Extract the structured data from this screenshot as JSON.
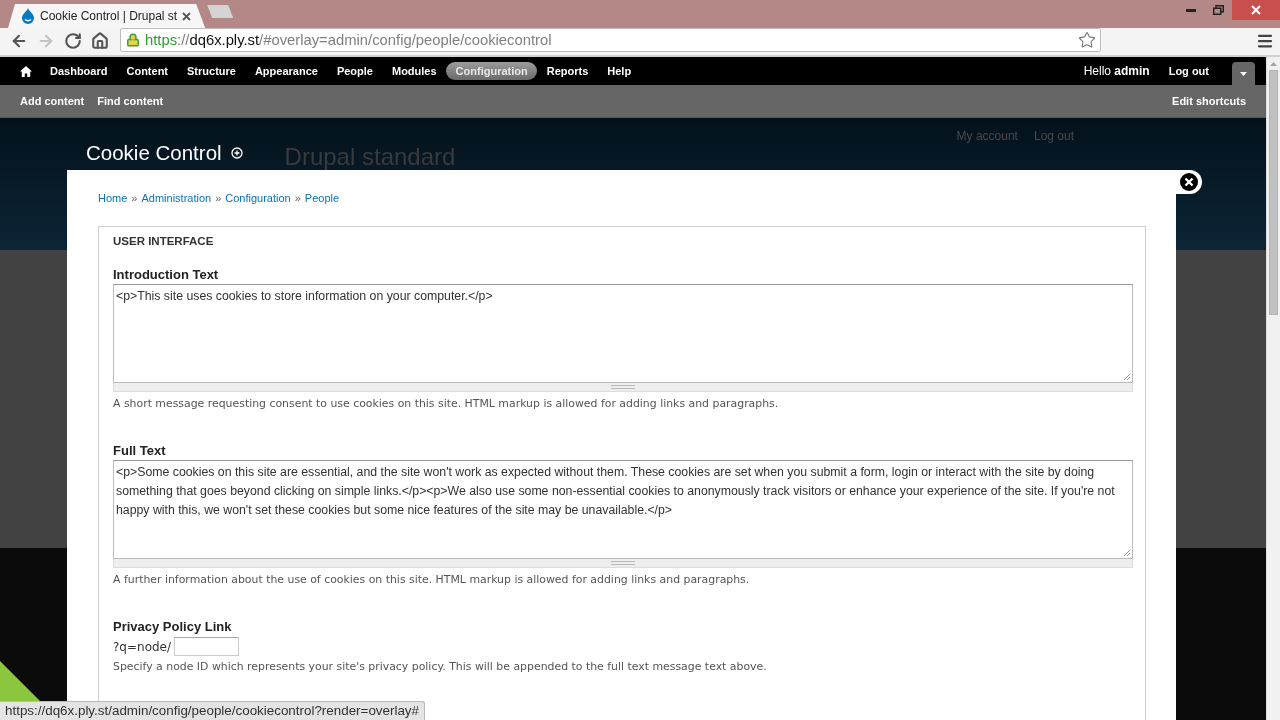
{
  "browser": {
    "tab": {
      "title": "Cookie Control | Drupal st"
    },
    "navigation": [
      {
        "kind": "back",
        "disabled": false
      },
      {
        "kind": "forward",
        "disabled": true
      },
      {
        "kind": "reload",
        "disabled": false
      },
      {
        "kind": "home",
        "disabled": false
      }
    ],
    "address": [
      {
        "kind": "scheme",
        "text": "https"
      },
      {
        "kind": "dim",
        "text": "://"
      },
      {
        "kind": "host",
        "text": "dq6x.ply.st"
      },
      {
        "kind": "dim",
        "text": "/#overlay=admin/config/people/cookiecontrol"
      }
    ],
    "status_url": "https://dq6x.ply.st/admin/config/people/cookiecontrol?render=overlay#"
  },
  "admin_toolbar": {
    "menu": [
      {
        "label": "Dashboard",
        "selected": false
      },
      {
        "label": "Content",
        "selected": false
      },
      {
        "label": "Structure",
        "selected": false
      },
      {
        "label": "Appearance",
        "selected": false
      },
      {
        "label": "People",
        "selected": false
      },
      {
        "label": "Modules",
        "selected": false
      },
      {
        "label": "Configuration",
        "selected": true
      },
      {
        "label": "Reports",
        "selected": false
      },
      {
        "label": "Help",
        "selected": false
      }
    ],
    "greeting": "Hello **admin**",
    "logout": "Log out"
  },
  "shortcuts": {
    "links": [
      "Add content",
      "Find content"
    ],
    "edit": "Edit shortcuts"
  },
  "site_header": {
    "page_title": "Cookie Control",
    "site_name": "Drupal standard",
    "secondary_menu": [
      "My account",
      "Log out"
    ]
  },
  "overlay": {
    "breadcrumb": {
      "separator": "»",
      "items": [
        "Home",
        "Administration",
        "Configuration",
        "People"
      ]
    },
    "fieldset": {
      "legend": "USER INTERFACE",
      "fields": [
        {
          "kind": "textarea",
          "label": "Introduction Text",
          "value": "<p>This site uses cookies to store information on your computer.</p>",
          "description": "A short message requesting consent to use cookies on this site. HTML markup is allowed for adding links and paragraphs."
        },
        {
          "kind": "textarea",
          "label": "Full Text",
          "value": "<p>Some cookies on this site are essential, and the site won't work as expected without them. These cookies are set when you submit a form, login or interact with the site by doing something that goes beyond clicking on simple links.</p><p>We also use some non-essential cookies to anonymously track visitors or enhance your experience of the site. If you're not happy with this, we won't set these cookies but some nice features of the site may be unavailable.</p>",
          "description": "A further information about the use of cookies on this site. HTML markup is allowed for adding links and paragraphs."
        },
        {
          "kind": "prefixed_text",
          "label": "Privacy Policy Link",
          "prefix": "?q=node/",
          "description": "Specify a node ID which represents your site's privacy policy. This will be appended to the full text message text above."
        }
      ]
    }
  }
}
